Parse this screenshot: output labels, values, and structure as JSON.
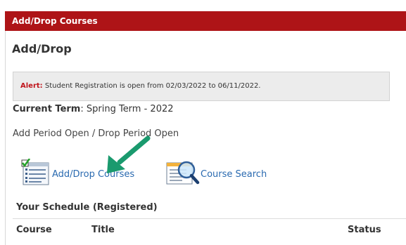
{
  "panel": {
    "header_title": "Add/Drop Courses",
    "section_title": "Add/Drop"
  },
  "alert": {
    "label": "Alert:",
    "message": "Student Registration is open from 02/03/2022 to 06/11/2022."
  },
  "term": {
    "label": "Current Term",
    "value": ": Spring Term - 2022"
  },
  "period_status": "Add Period Open / Drop Period Open",
  "links": {
    "add_drop": {
      "label": "Add/Drop Courses",
      "icon": "course-list-checkmark-icon"
    },
    "course_search": {
      "label": "Course Search",
      "icon": "magnifier-document-icon"
    }
  },
  "schedule": {
    "title": "Your Schedule (Registered)",
    "columns": [
      "Course",
      "Title",
      "Status"
    ]
  },
  "colors": {
    "header_bg": "#ae1417",
    "alert_label": "#c0151c",
    "link": "#2a6ab0",
    "arrow": "#1a9a6e"
  }
}
